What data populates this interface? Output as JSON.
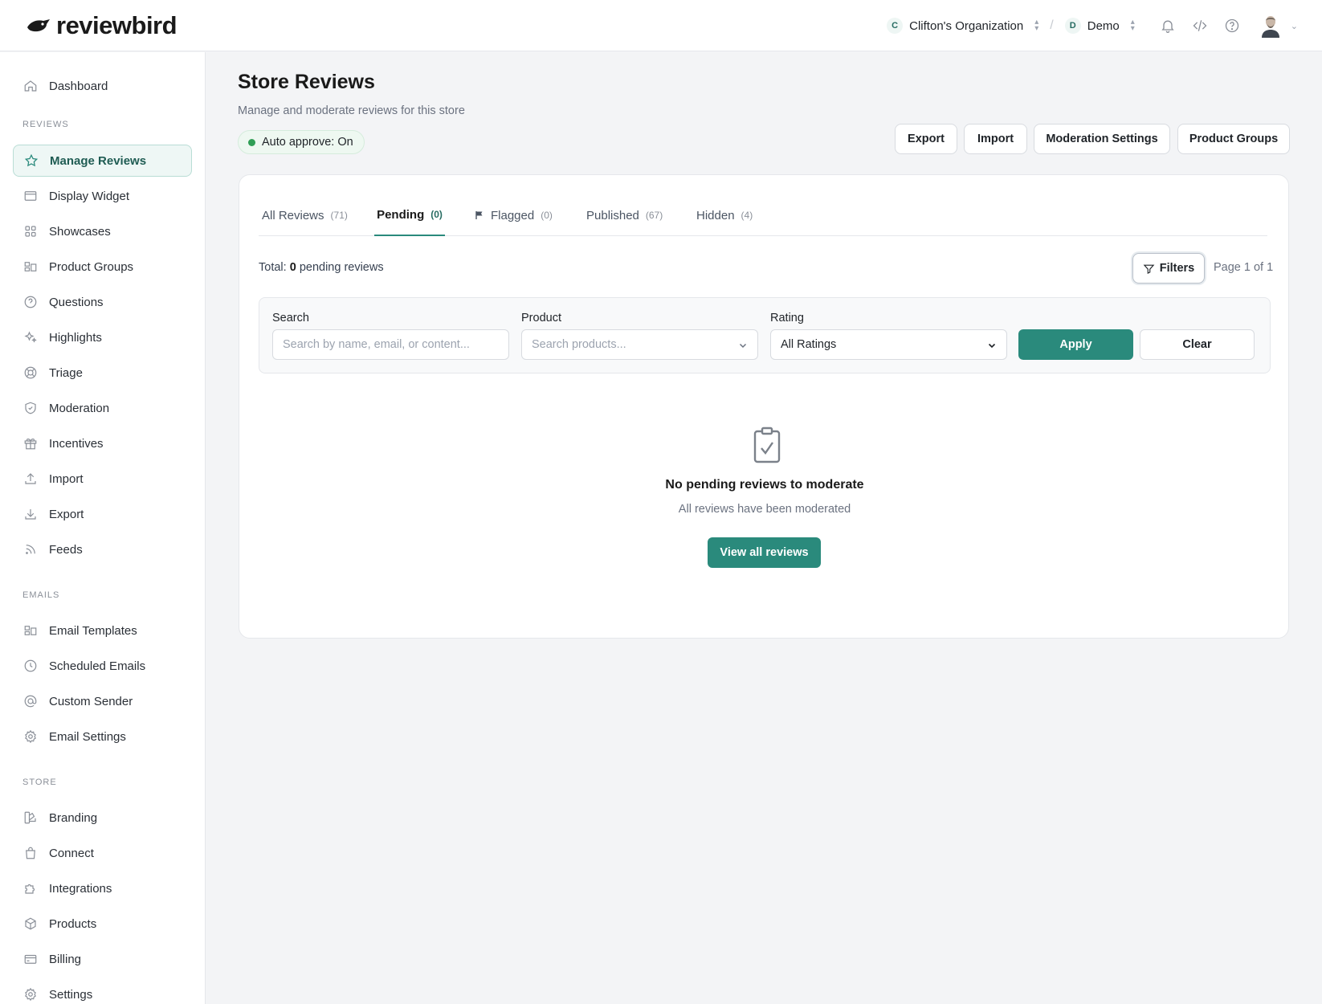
{
  "app": {
    "brand": "reviewbird",
    "organization": "Clifton's Organization",
    "organization_initial": "C",
    "store": "Demo",
    "store_initial": "D"
  },
  "sidebar": {
    "dashboard": "Dashboard",
    "sections": {
      "reviews": "REVIEWS",
      "emails": "EMAILS",
      "store": "STORE"
    },
    "reviews_items": [
      {
        "label": "Manage Reviews",
        "icon": "star-icon",
        "active": true
      },
      {
        "label": "Display Widget",
        "icon": "browser-window-icon"
      },
      {
        "label": "Showcases",
        "icon": "grid-icon"
      },
      {
        "label": "Product Groups",
        "icon": "layout-icon"
      },
      {
        "label": "Questions",
        "icon": "question-circle-icon"
      },
      {
        "label": "Highlights",
        "icon": "sparkles-icon"
      },
      {
        "label": "Triage",
        "icon": "lifebuoy-icon"
      },
      {
        "label": "Moderation",
        "icon": "shield-check-icon"
      },
      {
        "label": "Incentives",
        "icon": "gift-icon"
      },
      {
        "label": "Import",
        "icon": "upload-icon"
      },
      {
        "label": "Export",
        "icon": "download-icon"
      },
      {
        "label": "Feeds",
        "icon": "rss-icon"
      }
    ],
    "emails_items": [
      {
        "label": "Email Templates",
        "icon": "layout-icon"
      },
      {
        "label": "Scheduled Emails",
        "icon": "clock-icon"
      },
      {
        "label": "Custom Sender",
        "icon": "at-sign-icon"
      },
      {
        "label": "Email Settings",
        "icon": "gear-icon"
      }
    ],
    "store_items": [
      {
        "label": "Branding",
        "icon": "palette-icon"
      },
      {
        "label": "Connect",
        "icon": "shopping-bag-icon"
      },
      {
        "label": "Integrations",
        "icon": "puzzle-icon"
      },
      {
        "label": "Products",
        "icon": "box-icon"
      },
      {
        "label": "Billing",
        "icon": "credit-card-icon"
      },
      {
        "label": "Settings",
        "icon": "gear-icon"
      }
    ]
  },
  "header": {
    "title": "Store Reviews",
    "subtitle": "Manage and moderate reviews for this store",
    "auto_approve": "Auto approve: On",
    "actions": {
      "export": "Export",
      "import": "Import",
      "moderation_settings": "Moderation Settings",
      "product_groups": "Product Groups"
    }
  },
  "tabs": [
    {
      "label": "All Reviews",
      "count": "(71)"
    },
    {
      "label": "Pending",
      "count": "(0)",
      "active": true
    },
    {
      "label": "Flagged",
      "count": "(0)"
    },
    {
      "label": "Published",
      "count": "(67)"
    },
    {
      "label": "Hidden",
      "count": "(4)"
    }
  ],
  "summary": {
    "prefix": "Total:",
    "count": "0",
    "suffix": "pending reviews",
    "filters_label": "Filters",
    "page_info": "Page 1 of 1"
  },
  "filters": {
    "search_label": "Search",
    "search_placeholder": "Search by name, email, or content...",
    "product_label": "Product",
    "product_placeholder": "Search products...",
    "rating_label": "Rating",
    "rating_value": "All Ratings",
    "apply": "Apply",
    "clear": "Clear"
  },
  "empty_state": {
    "title": "No pending reviews to moderate",
    "subtitle": "All reviews have been moderated",
    "button": "View all reviews"
  },
  "colors": {
    "accent": "#2a8a7c",
    "status_green": "#2f9e55"
  }
}
